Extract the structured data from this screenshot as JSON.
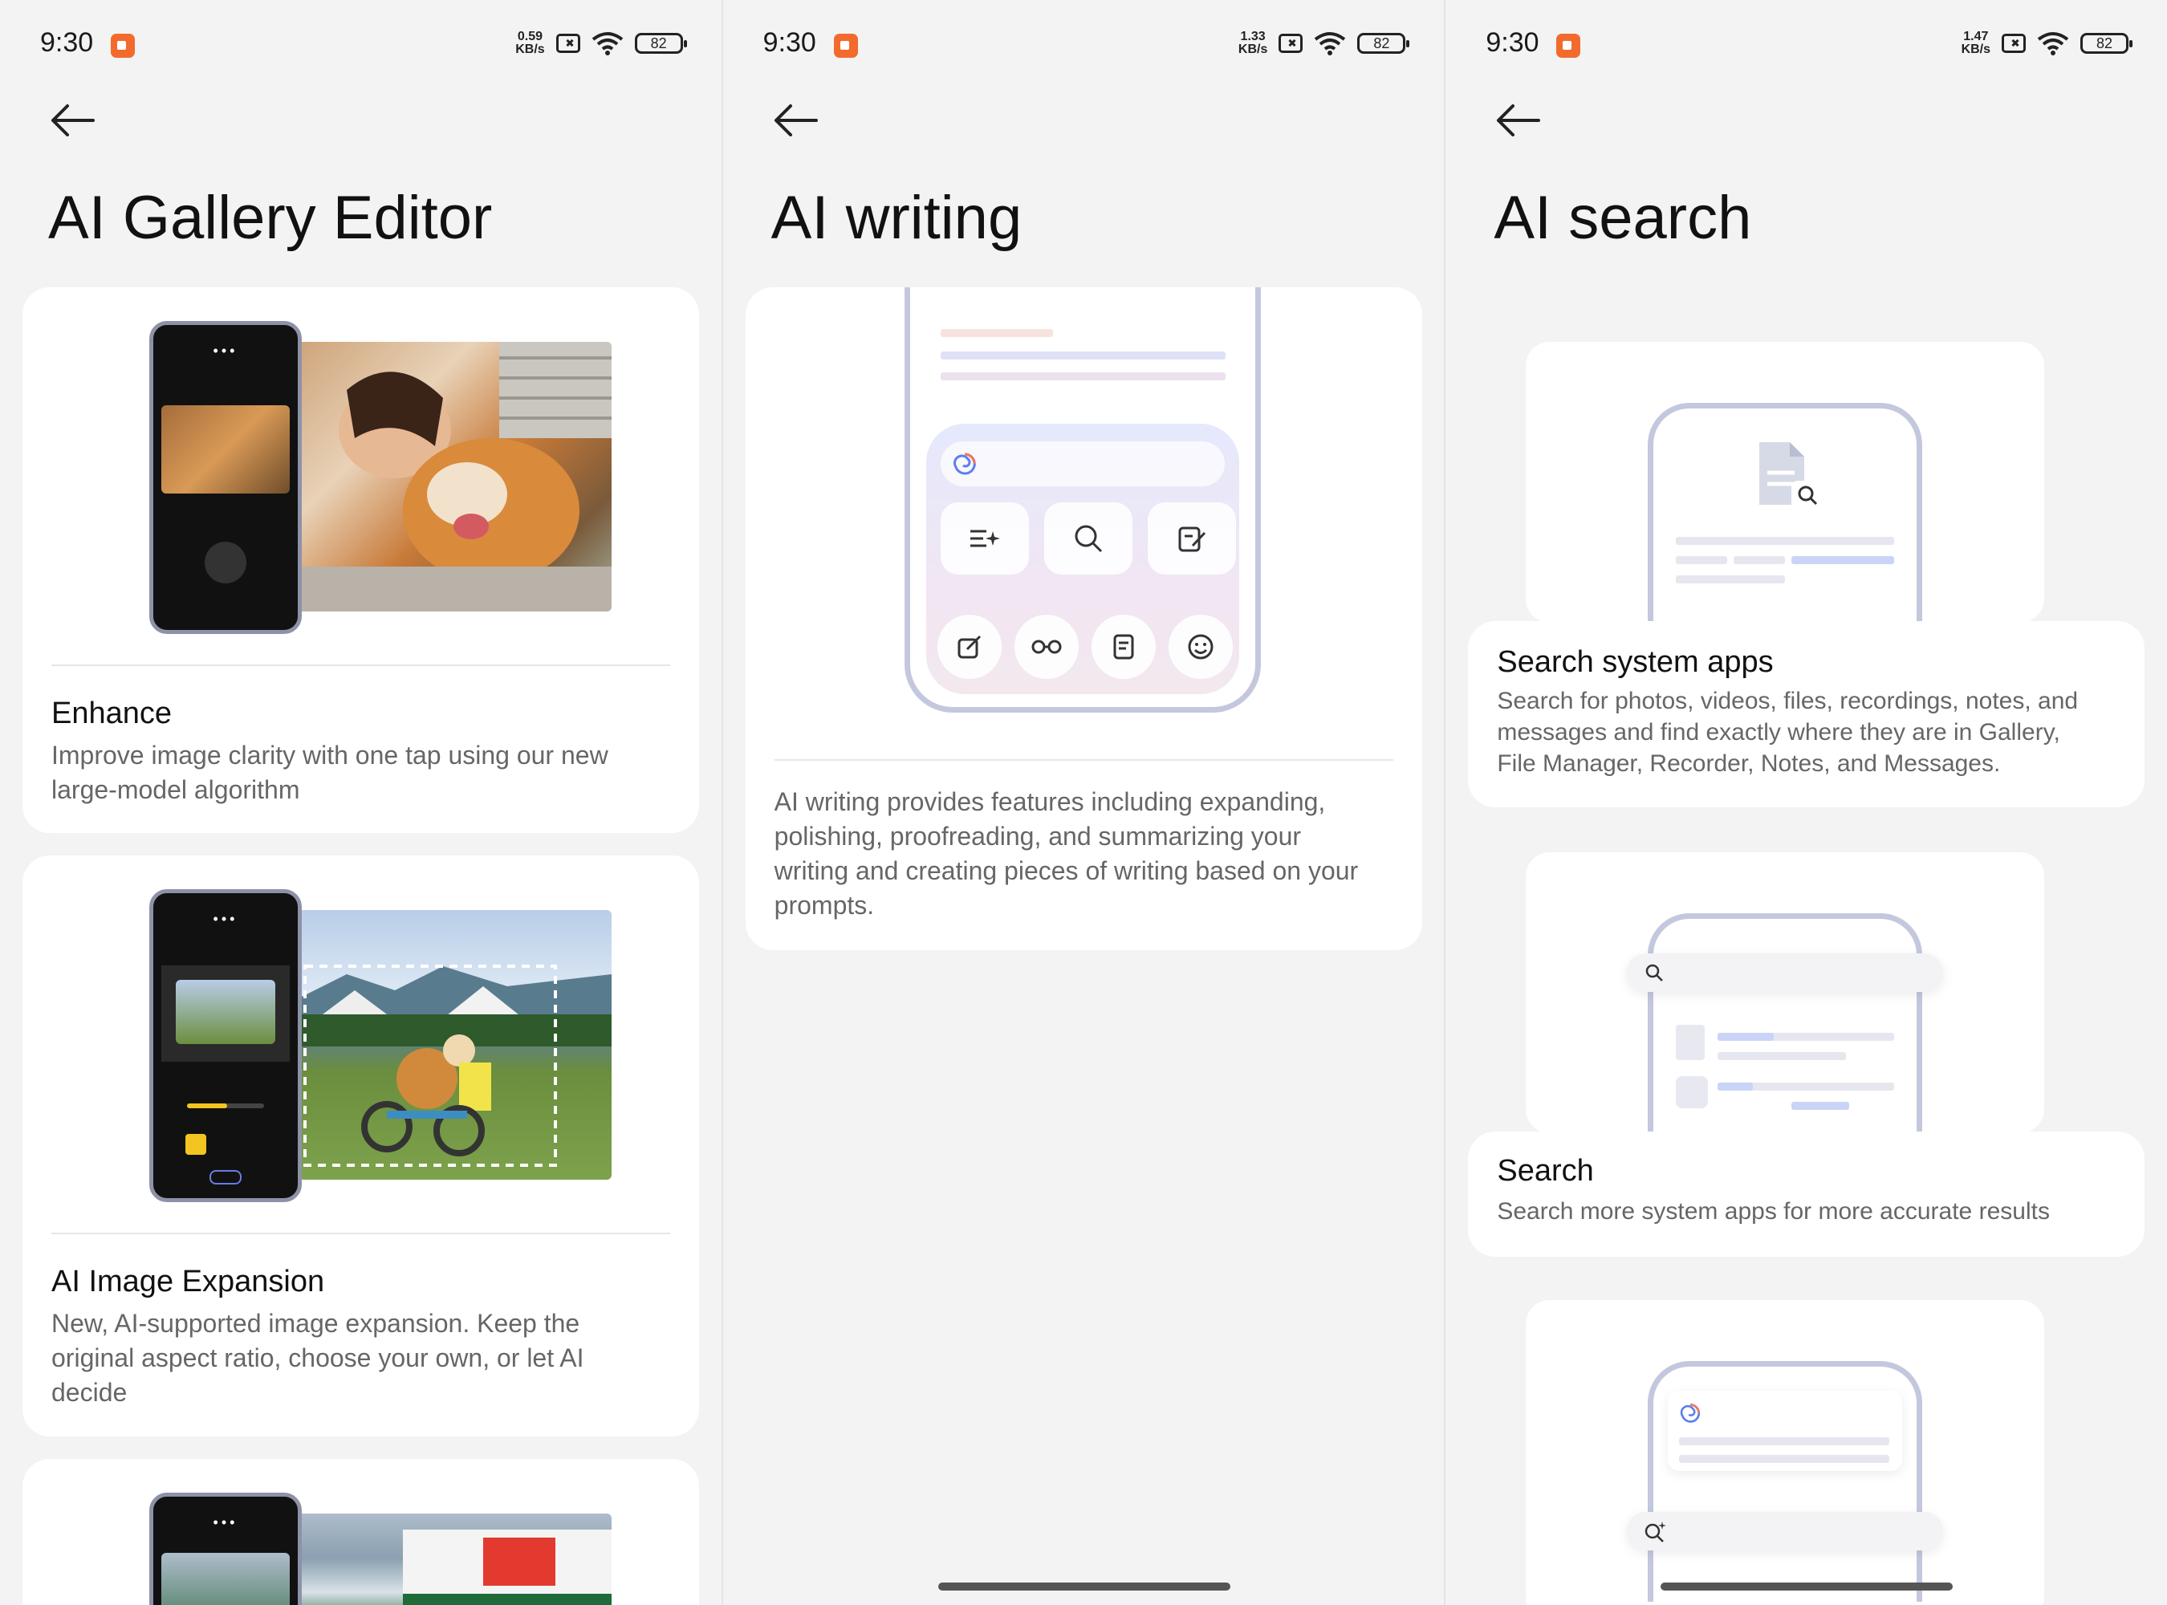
{
  "status_bar": {
    "time": "9:30",
    "screens": [
      {
        "speed_top": "0.59",
        "speed_bottom": "KB/s",
        "battery": "82"
      },
      {
        "speed_top": "1.33",
        "speed_bottom": "KB/s",
        "battery": "82"
      },
      {
        "speed_top": "1.47",
        "speed_bottom": "KB/s",
        "battery": "82"
      }
    ]
  },
  "screen1": {
    "title": "AI Gallery Editor",
    "cards": [
      {
        "title": "Enhance",
        "desc": "Improve image clarity with one tap using our new large-model algorithm"
      },
      {
        "title": "AI Image Expansion",
        "desc": "New, AI-supported image expansion. Keep the original aspect ratio, choose your own, or let AI decide"
      }
    ]
  },
  "screen2": {
    "title": "AI writing",
    "desc": "AI writing provides features including expanding, polishing, proofreading, and summarizing your writing and creating pieces of writing based on your prompts."
  },
  "screen3": {
    "title": "AI search",
    "cards": [
      {
        "title": "Search system apps",
        "desc": "Search for photos, videos, files, recordings, notes, and messages and find exactly where they are in Gallery, File Manager, Recorder, Notes, and Messages."
      },
      {
        "title": "Search",
        "desc": "Search more system apps for more accurate results"
      }
    ]
  },
  "colors": {
    "accent": "#f26b2c",
    "frame": "#c4c8de",
    "highlight": "#c9d4f7"
  }
}
